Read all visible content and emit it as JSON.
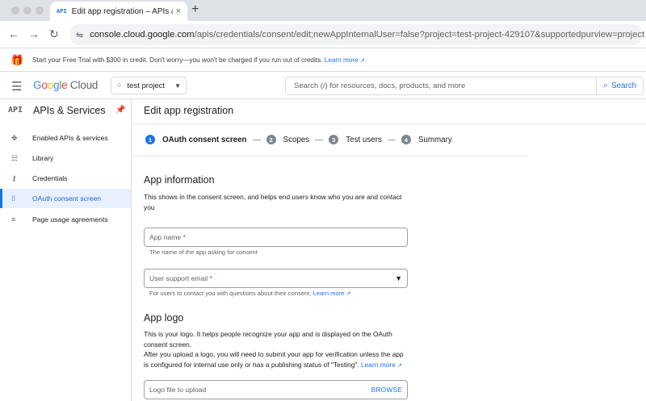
{
  "browser": {
    "tab_favicon": "API",
    "tab_title": "Edit app registration – APIs &",
    "tab_close": "×",
    "new_tab": "+",
    "back_icon": "←",
    "forward_icon": "→",
    "reload_icon": "↻",
    "site_info_icon": "⇋",
    "url_domain": "console.cloud.google.com",
    "url_path": "/apis/credentials/consent/edit;newAppInternalUser=false?project=test-project-429107&supportedpurview=project"
  },
  "banner": {
    "text": "Start your Free Trial with $300 in credit. Don't worry—you won't be charged if you run out of credits.",
    "link": "Learn more"
  },
  "header": {
    "logo_google": "Google",
    "logo_cloud": " Cloud",
    "project_name": "test project",
    "search_placeholder": "Search (/) for resources, docs, products, and more",
    "search_button": "Search"
  },
  "sidebar": {
    "badge": "API",
    "title": "APIs & Services",
    "items": [
      {
        "label": "Enabled APIs & services",
        "icon": "✥"
      },
      {
        "label": "Library",
        "icon": "☷"
      },
      {
        "label": "Credentials",
        "icon": "⚷"
      },
      {
        "label": "OAuth consent screen",
        "icon": "⁞⁞"
      },
      {
        "label": "Page usage agreements",
        "icon": "≡"
      }
    ]
  },
  "main": {
    "title": "Edit app registration",
    "steps": [
      {
        "num": "1",
        "label": "OAuth consent screen"
      },
      {
        "num": "2",
        "label": "Scopes"
      },
      {
        "num": "3",
        "label": "Test users"
      },
      {
        "num": "4",
        "label": "Summary"
      }
    ],
    "app_info": {
      "heading": "App information",
      "description": "This shows in the consent screen, and helps end users know who you are and contact you",
      "app_name_label": "App name",
      "app_name_hint": "The name of the app asking for consent",
      "support_email_label": "User support email",
      "support_email_hint": "For users to contact you with questions about their consent.",
      "support_email_link": "Learn more"
    },
    "app_logo": {
      "heading": "App logo",
      "description_1": "This is your logo. It helps people recognize your app and is displayed on the OAuth consent screen.",
      "description_2": "After you upload a logo, you will need to submit your app for verification unless the app is configured for internal use only or has a publishing status of \"Testing\".",
      "link": "Learn more",
      "upload_label": "Logo file to upload",
      "browse_button": "BROWSE"
    },
    "required_mark": "*"
  },
  "colors": {
    "accent": "#1a73e8",
    "active_nav_bg": "#e8f0fe",
    "required": "#d93025"
  }
}
